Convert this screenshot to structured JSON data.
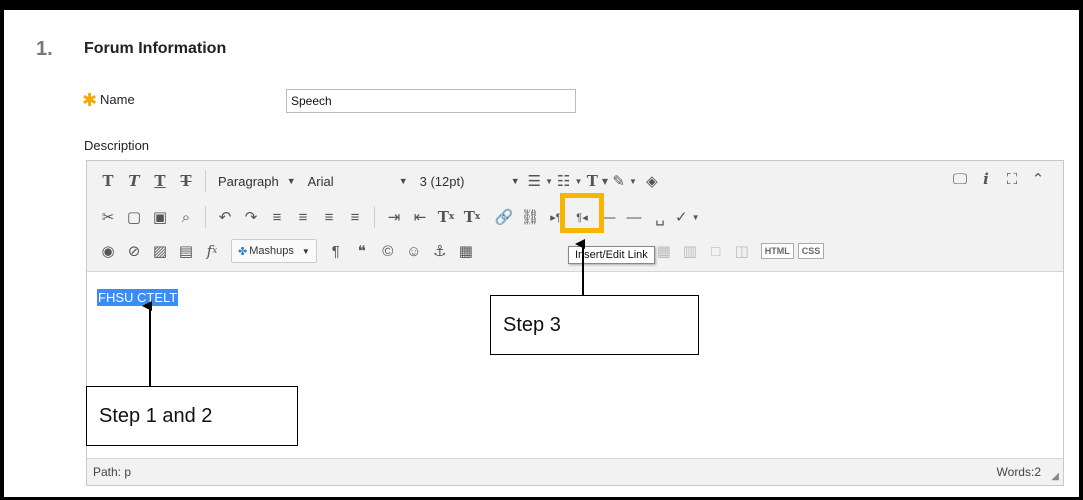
{
  "section": {
    "number": "1.",
    "title": "Forum Information"
  },
  "name_field": {
    "label": "Name",
    "value": "Speech"
  },
  "description": {
    "label": "Description"
  },
  "toolbar": {
    "paragraph_label": "Paragraph",
    "font_label": "Arial",
    "size_label": "3 (12pt)",
    "mashups_label": "Mashups",
    "html_label": "HTML",
    "css_label": "CSS"
  },
  "tooltip": {
    "text": "Insert/Edit Link"
  },
  "editor": {
    "content": "FHSU CTELT"
  },
  "statusbar": {
    "path": "Path: p",
    "words": "Words:2"
  },
  "callouts": {
    "step3": "Step 3",
    "step12": "Step 1 and 2"
  },
  "colors": {
    "highlight": "#f6b600",
    "selection": "#3b8cf5",
    "required": "#f2a900"
  },
  "icons": [
    "bold-icon",
    "italic-icon",
    "underline-icon",
    "strikethrough-icon",
    "cut-icon",
    "copy-icon",
    "paste-icon",
    "find-icon",
    "undo-icon",
    "redo-icon",
    "align-left-icon",
    "align-center-icon",
    "align-right-icon",
    "justify-icon",
    "indent-icon",
    "outdent-icon",
    "superscript-icon",
    "subscript-icon",
    "link-icon",
    "unlink-icon",
    "ltr-icon",
    "rtl-icon",
    "hr-icon",
    "nbsp-icon",
    "spellcheck-icon",
    "record-icon",
    "attach-icon",
    "image-icon",
    "media-icon",
    "formula-icon",
    "pilcrow-icon",
    "quote-icon",
    "copyright-icon",
    "emoticon-icon",
    "anchor-icon",
    "table-icon",
    "preview-icon",
    "info-icon",
    "fullscreen-icon",
    "collapse-icon"
  ]
}
